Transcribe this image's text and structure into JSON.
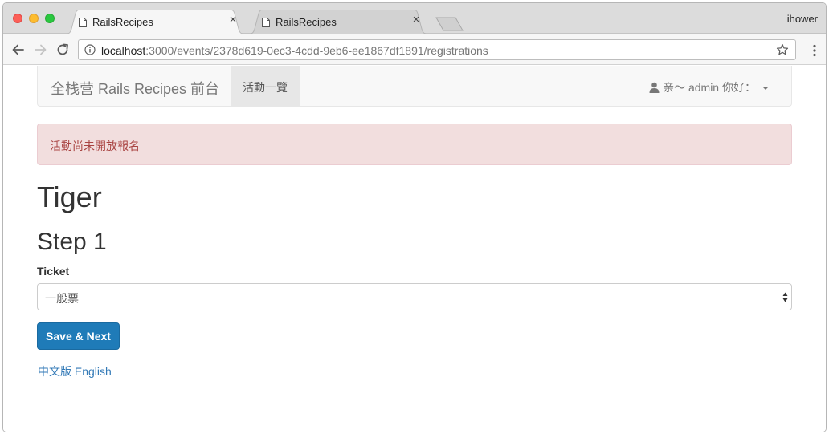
{
  "browser": {
    "tabs": [
      {
        "title": "RailsRecipes",
        "close": "×"
      },
      {
        "title": "RailsRecipes",
        "close": "×"
      }
    ],
    "profile_name": "ihower",
    "url_host": "localhost",
    "url_path": ":3000/events/2378d619-0ec3-4cdd-9eb6-ee1867df1891/registrations"
  },
  "navbar": {
    "brand": "全栈营 Rails Recipes 前台",
    "active_item": "活動一覽",
    "user_menu": "亲～ admin 你好："
  },
  "alert": {
    "message": "活動尚未開放報名"
  },
  "event": {
    "title": "Tiger",
    "step": "Step 1",
    "ticket_label": "Ticket",
    "ticket_selected": "一般票",
    "submit_label": "Save & Next"
  },
  "languages": [
    "中文版",
    "English"
  ],
  "colors": {
    "alert_bg": "#f2dede",
    "alert_text": "#a94442",
    "primary_button": "#1f7bb8",
    "link": "#337ab7"
  }
}
